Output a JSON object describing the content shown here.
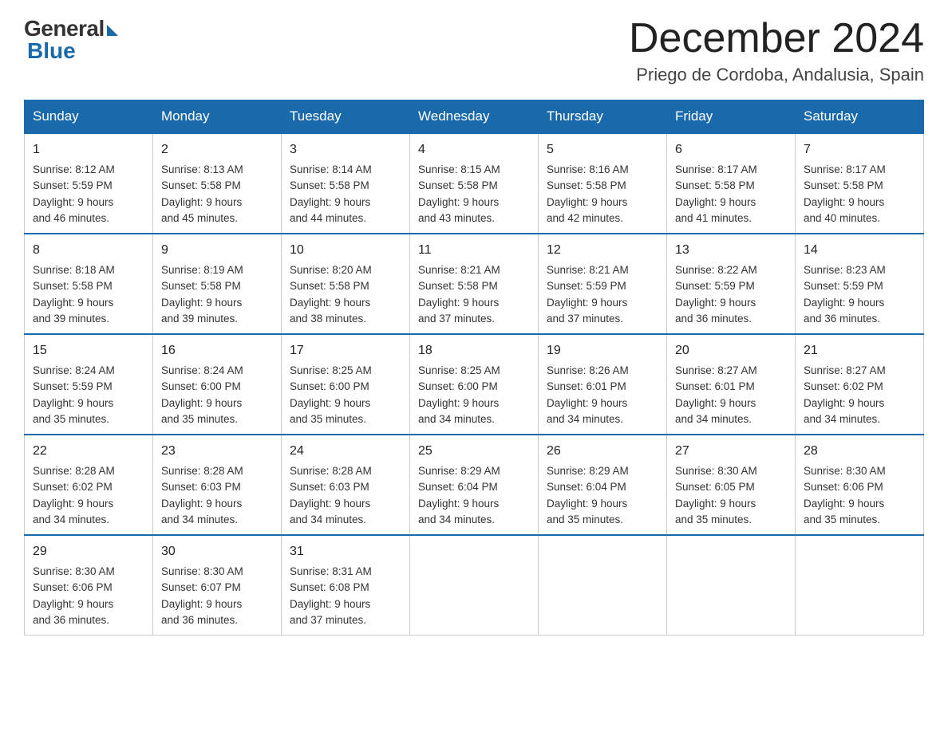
{
  "logo": {
    "general": "General",
    "blue": "Blue"
  },
  "title": "December 2024",
  "location": "Priego de Cordoba, Andalusia, Spain",
  "days_of_week": [
    "Sunday",
    "Monday",
    "Tuesday",
    "Wednesday",
    "Thursday",
    "Friday",
    "Saturday"
  ],
  "weeks": [
    [
      {
        "day": 1,
        "sunrise": "8:12 AM",
        "sunset": "5:59 PM",
        "daylight": "9 hours and 46 minutes."
      },
      {
        "day": 2,
        "sunrise": "8:13 AM",
        "sunset": "5:58 PM",
        "daylight": "9 hours and 45 minutes."
      },
      {
        "day": 3,
        "sunrise": "8:14 AM",
        "sunset": "5:58 PM",
        "daylight": "9 hours and 44 minutes."
      },
      {
        "day": 4,
        "sunrise": "8:15 AM",
        "sunset": "5:58 PM",
        "daylight": "9 hours and 43 minutes."
      },
      {
        "day": 5,
        "sunrise": "8:16 AM",
        "sunset": "5:58 PM",
        "daylight": "9 hours and 42 minutes."
      },
      {
        "day": 6,
        "sunrise": "8:17 AM",
        "sunset": "5:58 PM",
        "daylight": "9 hours and 41 minutes."
      },
      {
        "day": 7,
        "sunrise": "8:17 AM",
        "sunset": "5:58 PM",
        "daylight": "9 hours and 40 minutes."
      }
    ],
    [
      {
        "day": 8,
        "sunrise": "8:18 AM",
        "sunset": "5:58 PM",
        "daylight": "9 hours and 39 minutes."
      },
      {
        "day": 9,
        "sunrise": "8:19 AM",
        "sunset": "5:58 PM",
        "daylight": "9 hours and 39 minutes."
      },
      {
        "day": 10,
        "sunrise": "8:20 AM",
        "sunset": "5:58 PM",
        "daylight": "9 hours and 38 minutes."
      },
      {
        "day": 11,
        "sunrise": "8:21 AM",
        "sunset": "5:58 PM",
        "daylight": "9 hours and 37 minutes."
      },
      {
        "day": 12,
        "sunrise": "8:21 AM",
        "sunset": "5:59 PM",
        "daylight": "9 hours and 37 minutes."
      },
      {
        "day": 13,
        "sunrise": "8:22 AM",
        "sunset": "5:59 PM",
        "daylight": "9 hours and 36 minutes."
      },
      {
        "day": 14,
        "sunrise": "8:23 AM",
        "sunset": "5:59 PM",
        "daylight": "9 hours and 36 minutes."
      }
    ],
    [
      {
        "day": 15,
        "sunrise": "8:24 AM",
        "sunset": "5:59 PM",
        "daylight": "9 hours and 35 minutes."
      },
      {
        "day": 16,
        "sunrise": "8:24 AM",
        "sunset": "6:00 PM",
        "daylight": "9 hours and 35 minutes."
      },
      {
        "day": 17,
        "sunrise": "8:25 AM",
        "sunset": "6:00 PM",
        "daylight": "9 hours and 35 minutes."
      },
      {
        "day": 18,
        "sunrise": "8:25 AM",
        "sunset": "6:00 PM",
        "daylight": "9 hours and 34 minutes."
      },
      {
        "day": 19,
        "sunrise": "8:26 AM",
        "sunset": "6:01 PM",
        "daylight": "9 hours and 34 minutes."
      },
      {
        "day": 20,
        "sunrise": "8:27 AM",
        "sunset": "6:01 PM",
        "daylight": "9 hours and 34 minutes."
      },
      {
        "day": 21,
        "sunrise": "8:27 AM",
        "sunset": "6:02 PM",
        "daylight": "9 hours and 34 minutes."
      }
    ],
    [
      {
        "day": 22,
        "sunrise": "8:28 AM",
        "sunset": "6:02 PM",
        "daylight": "9 hours and 34 minutes."
      },
      {
        "day": 23,
        "sunrise": "8:28 AM",
        "sunset": "6:03 PM",
        "daylight": "9 hours and 34 minutes."
      },
      {
        "day": 24,
        "sunrise": "8:28 AM",
        "sunset": "6:03 PM",
        "daylight": "9 hours and 34 minutes."
      },
      {
        "day": 25,
        "sunrise": "8:29 AM",
        "sunset": "6:04 PM",
        "daylight": "9 hours and 34 minutes."
      },
      {
        "day": 26,
        "sunrise": "8:29 AM",
        "sunset": "6:04 PM",
        "daylight": "9 hours and 35 minutes."
      },
      {
        "day": 27,
        "sunrise": "8:30 AM",
        "sunset": "6:05 PM",
        "daylight": "9 hours and 35 minutes."
      },
      {
        "day": 28,
        "sunrise": "8:30 AM",
        "sunset": "6:06 PM",
        "daylight": "9 hours and 35 minutes."
      }
    ],
    [
      {
        "day": 29,
        "sunrise": "8:30 AM",
        "sunset": "6:06 PM",
        "daylight": "9 hours and 36 minutes."
      },
      {
        "day": 30,
        "sunrise": "8:30 AM",
        "sunset": "6:07 PM",
        "daylight": "9 hours and 36 minutes."
      },
      {
        "day": 31,
        "sunrise": "8:31 AM",
        "sunset": "6:08 PM",
        "daylight": "9 hours and 37 minutes."
      },
      null,
      null,
      null,
      null
    ]
  ],
  "labels": {
    "sunrise": "Sunrise:",
    "sunset": "Sunset:",
    "daylight": "Daylight:"
  }
}
